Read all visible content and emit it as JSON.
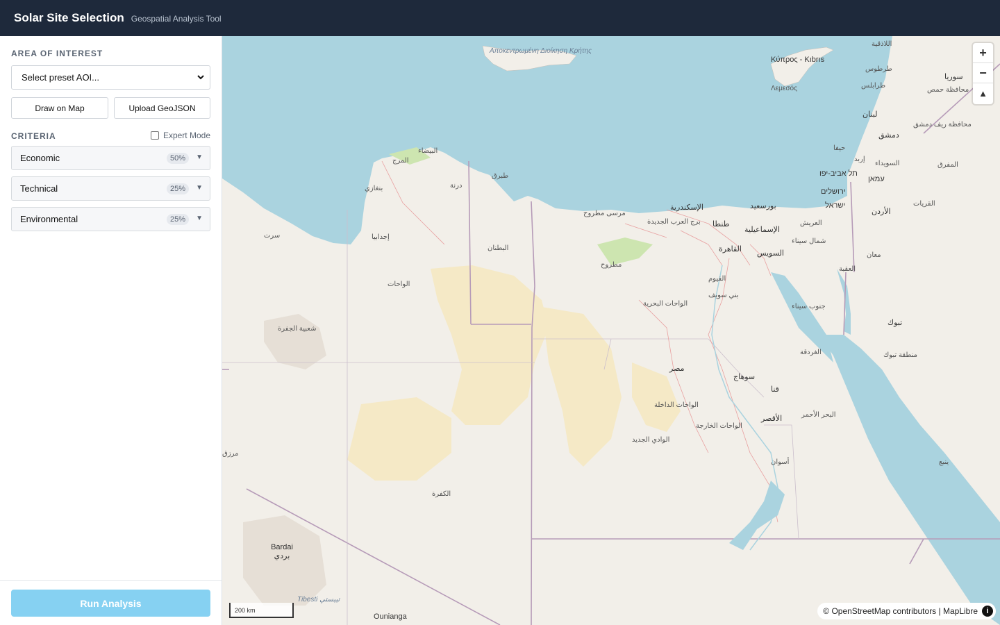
{
  "header": {
    "title": "Solar Site Selection",
    "subtitle": "Geospatial Analysis Tool"
  },
  "sidebar": {
    "aoi_label": "AREA OF INTEREST",
    "aoi_select": "Select preset AOI...",
    "draw_button": "Draw on Map",
    "upload_button": "Upload GeoJSON",
    "criteria_label": "CRITERIA",
    "expert_mode": "Expert Mode",
    "criteria": [
      {
        "name": "Economic",
        "weight": "50%"
      },
      {
        "name": "Technical",
        "weight": "25%"
      },
      {
        "name": "Environmental",
        "weight": "25%"
      }
    ],
    "run_button": "Run Analysis"
  },
  "map": {
    "labels": [
      "Αποκεντρωμένη Διοίκηση Κρήτης",
      "Κύπρος - Kıbrıs",
      "Λεμεσός",
      "اللاذقية",
      "طرطوس",
      "سوريا",
      "طرابلس",
      "محافظة حمص",
      "لبنان",
      "دمشق",
      "محافظة ريف دمشق",
      "حيفا",
      "إربد",
      "السويداء",
      "المفرق",
      "תל אביב-יפו",
      "עמאן",
      "ירושלים",
      "ישראל",
      "الأردن",
      "القريات",
      "البيضاء",
      "المرج",
      "طبرق",
      "درنة",
      "بنغازي",
      "إجدابيا",
      "سرت",
      "الإسكندرية",
      "بورسعيد",
      "مرسى مطروح",
      "برج العرب الجديدة",
      "طنطا",
      "الإسماعيلية",
      "العريش",
      "مطروح",
      "القاهرة",
      "السويس",
      "شمال سيناء",
      "البطنان",
      "الواحات",
      "الفيوم",
      "بني سويف",
      "الواحات البحرية",
      "جنوب سيناء",
      "العقبة",
      "معان",
      "تبوك",
      "شعبية الجفرة",
      "مصر",
      "سوهاج",
      "قنا",
      "الأقصر",
      "الغردقة",
      "البحر الأحمر",
      "الواحات الداخلة",
      "الواحات الخارجة",
      "الوادي الجديد",
      "منطقة تبوك",
      "أسوان",
      "ينبع",
      "الكفرة",
      "مرزق",
      "Bardai بردي",
      "Tibesti تيبستي",
      "Ounianga"
    ],
    "zoom_in": "+",
    "zoom_out": "−",
    "compass": "▲",
    "scale": "200 km",
    "attribution": "© OpenStreetMap contributors | MapLibre",
    "info_icon": "i",
    "colors": {
      "sea": "#aad3df",
      "land": "#f2efe9",
      "desert": "#f5e9c6",
      "border": "#b69bb8",
      "road": "#e8a0a0"
    }
  }
}
